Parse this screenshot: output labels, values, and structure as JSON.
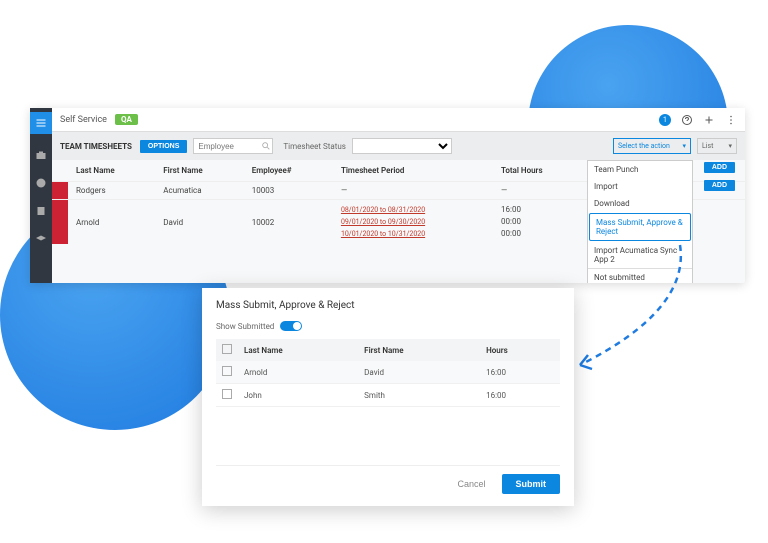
{
  "topbar": {
    "title": "Self Service",
    "badge": "QA",
    "notif_count": "1"
  },
  "filters": {
    "section_title": "TEAM TIMESHEETS",
    "options_label": "OPTIONS",
    "employee_placeholder": "Employee",
    "status_label": "Timesheet Status",
    "action_placeholder": "Select the action",
    "list_label": "List"
  },
  "columns": {
    "last_name": "Last Name",
    "first_name": "First Name",
    "employee_no": "Employee#",
    "period": "Timesheet Period",
    "total_hours": "Total Hours"
  },
  "rows": [
    {
      "last": "Rodgers",
      "first": "Acumatica",
      "emp": "10003",
      "periods": [
        "—"
      ],
      "hours": [
        "—"
      ]
    },
    {
      "last": "Arnold",
      "first": "David",
      "emp": "10002",
      "periods": [
        "08/01/2020 to 08/31/2020",
        "09/01/2020 to 09/30/2020",
        "10/01/2020 to 10/31/2020"
      ],
      "hours": [
        "16:00",
        "00:00",
        "00:00"
      ]
    }
  ],
  "dropdown": {
    "items": [
      "Team Punch",
      "Import",
      "Download",
      "Mass Submit, Approve & Reject",
      "Import Acumatica Sync App 2"
    ]
  },
  "buttons": {
    "add": "ADD"
  },
  "status_text": {
    "not_submitted": "Not submitted"
  },
  "modal": {
    "title": "Mass Submit, Approve & Reject",
    "show_submitted": "Show Submitted",
    "cols": {
      "last": "Last Name",
      "first": "First Name",
      "hours": "Hours"
    },
    "rows": [
      {
        "last": "Arnold",
        "first": "David",
        "hours": "16:00"
      },
      {
        "last": "John",
        "first": "Smith",
        "hours": "16:00"
      }
    ],
    "cancel": "Cancel",
    "submit": "Submit"
  }
}
